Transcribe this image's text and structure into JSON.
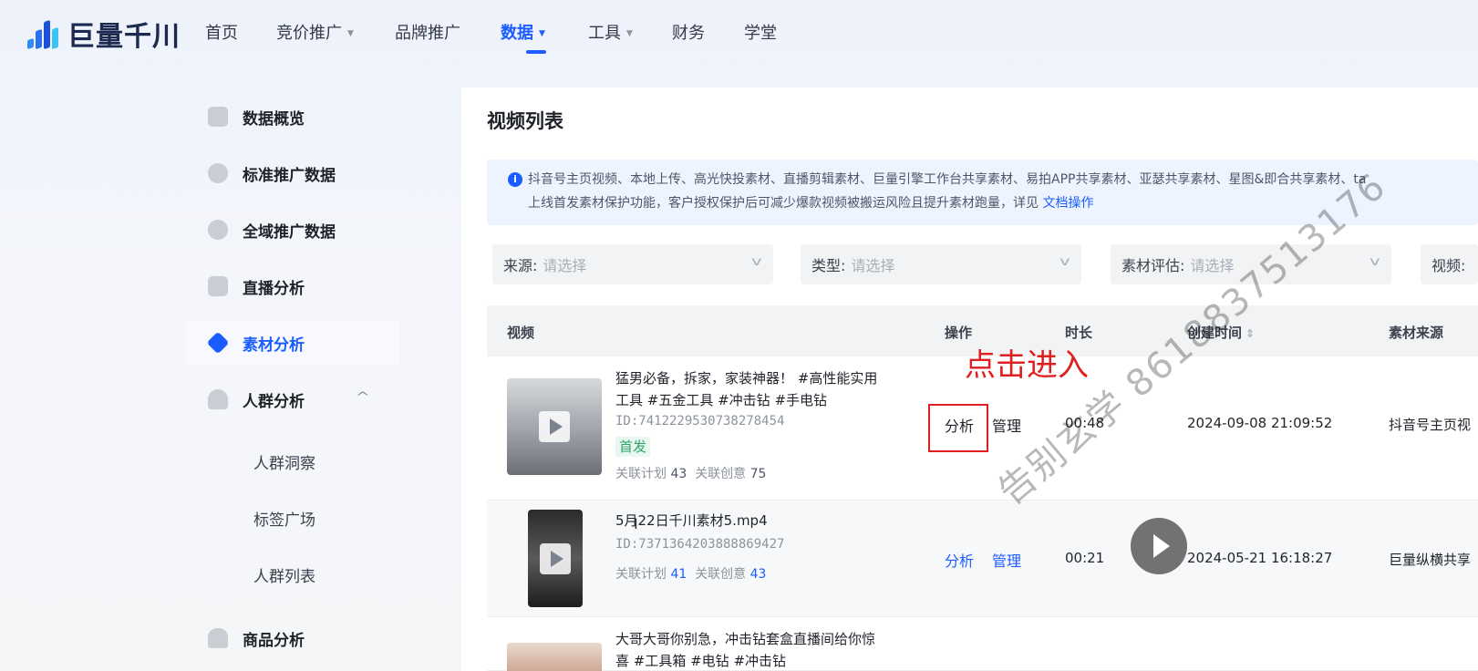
{
  "brand": {
    "name": "巨量千川"
  },
  "nav": {
    "items": [
      {
        "label": "首页",
        "caret": false
      },
      {
        "label": "竞价推广",
        "caret": true
      },
      {
        "label": "品牌推广",
        "caret": false
      },
      {
        "label": "数据",
        "caret": true,
        "active": true
      },
      {
        "label": "工具",
        "caret": true
      },
      {
        "label": "财务",
        "caret": false
      },
      {
        "label": "学堂",
        "caret": false
      }
    ]
  },
  "sidebar": {
    "items": [
      {
        "label": "数据概览",
        "icon": "chart-bar-icon"
      },
      {
        "label": "标准推广数据",
        "icon": "bar-chart-icon"
      },
      {
        "label": "全域推广数据",
        "icon": "check-circle-icon"
      },
      {
        "label": "直播分析",
        "icon": "tv-icon"
      },
      {
        "label": "素材分析",
        "icon": "layers-icon",
        "active": true
      },
      {
        "label": "人群分析",
        "icon": "users-icon",
        "expanded": true
      },
      {
        "label": "商品分析",
        "icon": "bag-icon"
      }
    ],
    "subitems": [
      "人群洞察",
      "标签广场",
      "人群列表"
    ]
  },
  "main": {
    "title": "视频列表",
    "notice": {
      "line1": "抖音号主页视频、本地上传、高光快投素材、直播剪辑素材、巨量引擎工作台共享素材、易拍APP共享素材、亚瑟共享素材、星图&即合共享素材、ta",
      "line2": "上线首发素材保护功能，客户授权保护后可减少爆款视频被搬运风险且提升素材跑量，详见",
      "link": "文档操作"
    },
    "filters": [
      {
        "label": "来源:",
        "placeholder": "请选择"
      },
      {
        "label": "类型:",
        "placeholder": "请选择"
      },
      {
        "label": "素材评估:",
        "placeholder": "请选择"
      },
      {
        "label": "视频:",
        "placeholder": ""
      }
    ],
    "table": {
      "headers": {
        "video": "视频",
        "ops": "操作",
        "duration": "时长",
        "created": "创建时间",
        "source": "素材来源"
      },
      "rows": [
        {
          "title_line1": "猛男必备，拆家，家装神器！ #高性能实用",
          "title_line2": "工具 #五金工具 #冲击钻 #手电钻",
          "id": "ID:7412229530738278454",
          "badge": "首发",
          "rel_plan_label": "关联计划",
          "rel_plan": "43",
          "rel_idea_label": "关联创意",
          "rel_idea": "75",
          "op_analyze": "分析",
          "op_manage": "管理",
          "duration": "00:48",
          "created": "2024-09-08 21:09:52",
          "source": "抖音号主页视"
        },
        {
          "title_line1": "5月22日千川素材5.mp4",
          "id": "ID:7371364203888869427",
          "rel_plan_label": "关联计划",
          "rel_plan": "41",
          "rel_idea_label": "关联创意",
          "rel_idea": "43",
          "op_analyze": "分析",
          "op_manage": "管理",
          "duration": "00:21",
          "created": "2024-05-21 16:18:27",
          "source": "巨量纵横共享"
        },
        {
          "title_line1": "大哥大哥你别急，冲击钻套盒直播间给你惊",
          "title_line2": "喜 #工具箱 #电钻 #冲击钻"
        }
      ]
    }
  },
  "annotation": {
    "callout": "点击进入"
  },
  "watermark": {
    "text": "告别玄学 8618837513176"
  },
  "colors": {
    "accent": "#1a5cff",
    "annotation": "#e02020",
    "badge": "#2fa36b"
  }
}
